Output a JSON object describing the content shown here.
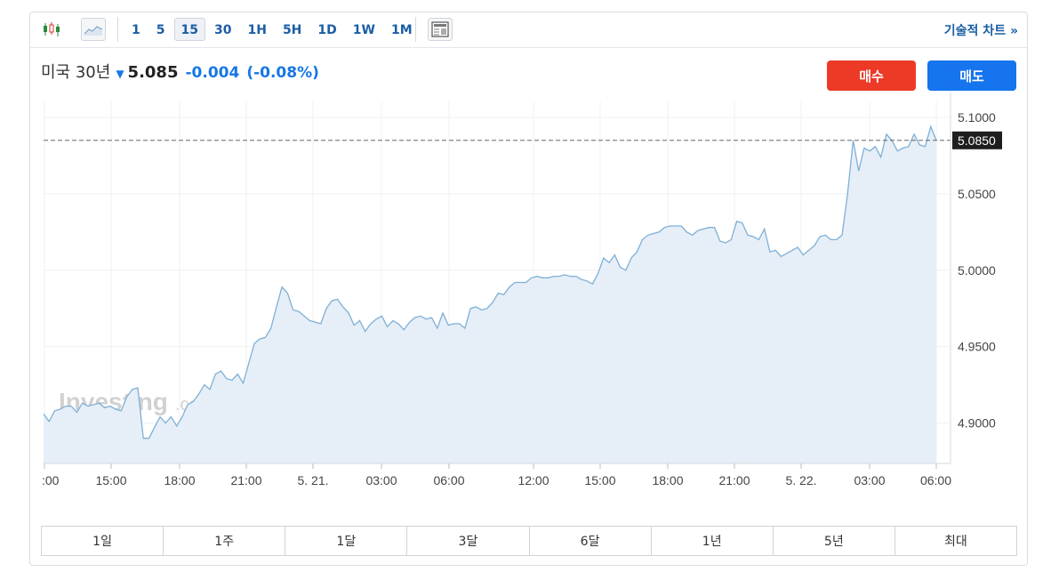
{
  "toolbar": {
    "intervals": [
      "1",
      "5",
      "15",
      "30",
      "1H",
      "5H",
      "1D",
      "1W",
      "1M"
    ],
    "active_interval": "15",
    "technical_chart_label": "기술적 차트 »"
  },
  "quote": {
    "name": "미국 30년",
    "price": "5.085",
    "change": "-0.004",
    "change_pct": "(-0.08%)",
    "direction": "down"
  },
  "buttons": {
    "buy_label": "매수",
    "sell_label": "매도"
  },
  "watermark": {
    "brand": "Investing",
    "suffix": ".com"
  },
  "ranges": [
    "1일",
    "1주",
    "1달",
    "3달",
    "6달",
    "1년",
    "5년",
    "최대"
  ],
  "colors": {
    "line": "#7fb0d6",
    "fill": "#e6eef7",
    "buy": "#ec3a27",
    "sell": "#1574ee",
    "down": "#1777e6",
    "link": "#1b5ea4"
  },
  "chart_data": {
    "type": "area",
    "y_ticks": [
      "5.1000",
      "5.0500",
      "5.0000",
      "4.9500",
      "4.9000"
    ],
    "y_tick_values": [
      5.1,
      5.05,
      5.0,
      4.95,
      4.9
    ],
    "ylim": [
      4.8735,
      5.1105
    ],
    "x_ticks": [
      ":00",
      "15:00",
      "18:00",
      "21:00",
      "5. 21.",
      "03:00",
      "06:00",
      "12:00",
      "15:00",
      "18:00",
      "21:00",
      "5. 22.",
      "03:00",
      "06:00"
    ],
    "current_value_label": "5.0850",
    "current_value": 5.085,
    "grid": true,
    "values": [
      4.906,
      4.901,
      4.908,
      4.909,
      4.911,
      4.911,
      4.907,
      4.913,
      4.911,
      4.912,
      4.913,
      4.91,
      4.911,
      4.909,
      4.908,
      4.917,
      4.922,
      4.923,
      4.89,
      4.89,
      4.897,
      4.904,
      4.9,
      4.904,
      4.898,
      4.904,
      4.912,
      4.914,
      4.919,
      4.925,
      4.922,
      4.932,
      4.934,
      4.929,
      4.928,
      4.932,
      4.926,
      4.939,
      4.952,
      4.955,
      4.956,
      4.962,
      4.976,
      4.989,
      4.985,
      4.974,
      4.973,
      4.97,
      4.967,
      4.966,
      4.965,
      4.975,
      4.98,
      4.981,
      4.976,
      4.972,
      4.964,
      4.967,
      4.96,
      4.965,
      4.968,
      4.97,
      4.963,
      4.967,
      4.965,
      4.961,
      4.966,
      4.969,
      4.97,
      4.968,
      4.969,
      4.962,
      4.972,
      4.964,
      4.965,
      4.965,
      4.962,
      4.975,
      4.976,
      4.974,
      4.975,
      4.979,
      4.985,
      4.984,
      4.989,
      4.992,
      4.992,
      4.992,
      4.995,
      4.996,
      4.995,
      4.995,
      4.996,
      4.996,
      4.997,
      4.996,
      4.996,
      4.994,
      4.993,
      4.991,
      4.998,
      5.008,
      5.005,
      5.01,
      5.002,
      5.0,
      5.008,
      5.012,
      5.02,
      5.023,
      5.024,
      5.025,
      5.028,
      5.029,
      5.029,
      5.029,
      5.025,
      5.023,
      5.026,
      5.027,
      5.028,
      5.028,
      5.019,
      5.018,
      5.02,
      5.032,
      5.031,
      5.023,
      5.022,
      5.02,
      5.027,
      5.012,
      5.013,
      5.009,
      5.011,
      5.013,
      5.015,
      5.01,
      5.013,
      5.016,
      5.022,
      5.023,
      5.02,
      5.02,
      5.023,
      5.05,
      5.085,
      5.065,
      5.08,
      5.078,
      5.081,
      5.074,
      5.089,
      5.085,
      5.078,
      5.08,
      5.081,
      5.089,
      5.082,
      5.081,
      5.094,
      5.085
    ]
  }
}
